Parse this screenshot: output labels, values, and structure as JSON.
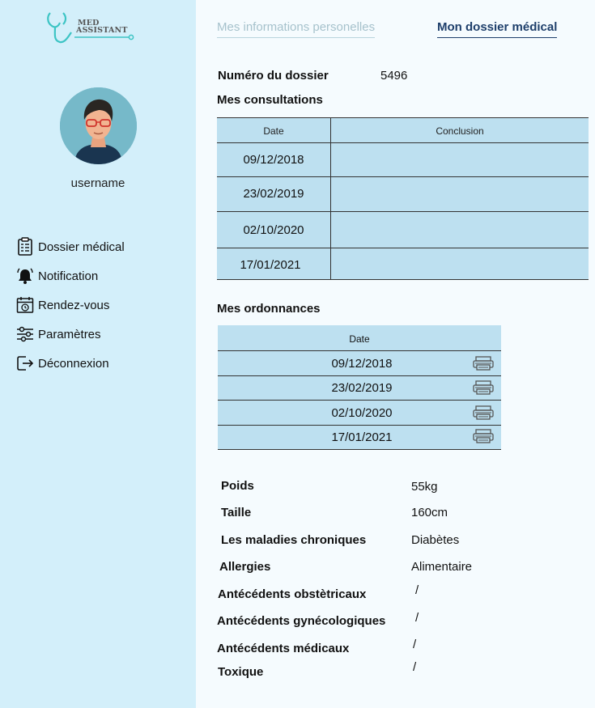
{
  "app": {
    "logo_line1": "MED",
    "logo_line2": "ASSISTANT"
  },
  "sidebar": {
    "username": "username",
    "items": [
      {
        "label": "Dossier médical",
        "icon": "clipboard-icon"
      },
      {
        "label": "Notification",
        "icon": "bell-icon"
      },
      {
        "label": "Rendez-vous",
        "icon": "calendar-clock-icon"
      },
      {
        "label": "Paramètres",
        "icon": "sliders-icon"
      },
      {
        "label": "Déconnexion",
        "icon": "logout-icon"
      }
    ]
  },
  "tabs": {
    "personal": "Mes informations personelles",
    "medical": "Mon dossier médical"
  },
  "dossier": {
    "label": "Numéro du dossier",
    "value": "5496"
  },
  "consultations": {
    "title": "Mes consultations",
    "headers": [
      "Date",
      "Conclusion"
    ],
    "rows": [
      {
        "date": "09/12/2018",
        "conclusion": ""
      },
      {
        "date": "23/02/2019",
        "conclusion": ""
      },
      {
        "date": "02/10/2020",
        "conclusion": ""
      },
      {
        "date": "17/01/2021",
        "conclusion": ""
      }
    ]
  },
  "ordonnances": {
    "title": "Mes ordonnances",
    "header": "Date",
    "rows": [
      "09/12/2018",
      "23/02/2019",
      "02/10/2020",
      "17/01/2021"
    ]
  },
  "info": [
    {
      "label": "Poids",
      "value": "55kg"
    },
    {
      "label": "Taille",
      "value": "160cm"
    },
    {
      "label": "Les maladies chroniques",
      "value": "Diabètes"
    },
    {
      "label": "Allergies",
      "value": "Alimentaire"
    },
    {
      "label": "Antécédents obstètricaux",
      "value": "/"
    },
    {
      "label": "Antécédents gynécologiques",
      "value": "/"
    },
    {
      "label": "Antécédents médicaux",
      "value": "/"
    },
    {
      "label": "Toxique",
      "value": "/"
    }
  ],
  "colors": {
    "sidebar_bg": "#d3effa",
    "table_bg": "#bde0f0",
    "active_tab": "#1e3f6b",
    "inactive_tab": "#a6c2cc",
    "logo_teal": "#3cc4c4"
  }
}
